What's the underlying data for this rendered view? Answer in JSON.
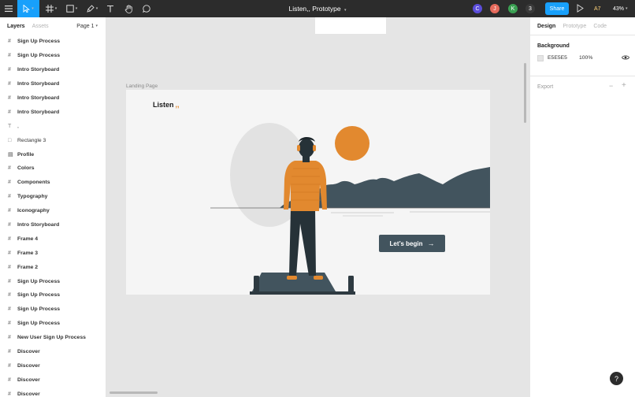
{
  "toolbar": {
    "doc_title": "Listen,, Prototype",
    "share_label": "Share",
    "a7_label": "A7",
    "zoom_label": "43%",
    "avatars": [
      {
        "letter": "C",
        "color": "#5b4ddb"
      },
      {
        "letter": "J",
        "color": "#e66a5c"
      },
      {
        "letter": "K",
        "color": "#3aa052"
      },
      {
        "letter": "3",
        "color": "#3a3a3a"
      }
    ],
    "active_tool_color": "#18a0fb"
  },
  "layers_panel": {
    "tabs": [
      "Layers",
      "Assets"
    ],
    "page_label": "Page 1",
    "items": [
      {
        "icon": "frame",
        "label": "Sign Up Process"
      },
      {
        "icon": "frame",
        "label": "Sign Up Process"
      },
      {
        "icon": "frame",
        "label": "Intro Storyboard"
      },
      {
        "icon": "frame",
        "label": "Intro Storyboard"
      },
      {
        "icon": "frame",
        "label": "Intro Storyboard"
      },
      {
        "icon": "frame",
        "label": "Intro Storyboard"
      },
      {
        "icon": "text",
        "label": ","
      },
      {
        "icon": "rect",
        "label": "Rectangle 3"
      },
      {
        "icon": "component",
        "label": "Profile"
      },
      {
        "icon": "frame",
        "label": "Colors"
      },
      {
        "icon": "frame",
        "label": "Components"
      },
      {
        "icon": "frame",
        "label": "Typography"
      },
      {
        "icon": "frame",
        "label": "Iconography"
      },
      {
        "icon": "frame",
        "label": "Intro Storyboard"
      },
      {
        "icon": "frame",
        "label": "Frame 4"
      },
      {
        "icon": "frame",
        "label": "Frame 3"
      },
      {
        "icon": "frame",
        "label": "Frame 2"
      },
      {
        "icon": "frame",
        "label": "Sign Up Process"
      },
      {
        "icon": "frame",
        "label": "Sign Up Process"
      },
      {
        "icon": "frame",
        "label": "Sign Up Process"
      },
      {
        "icon": "frame",
        "label": "Sign Up Process"
      },
      {
        "icon": "frame",
        "label": "New User Sign Up Process"
      },
      {
        "icon": "frame",
        "label": "Discover"
      },
      {
        "icon": "frame",
        "label": "Discover"
      },
      {
        "icon": "frame",
        "label": "Discover"
      },
      {
        "icon": "frame",
        "label": "Discover"
      }
    ]
  },
  "canvas": {
    "frame_label": "Landing Page",
    "logo_text": "Listen",
    "logo_dots": ",,",
    "cta_label": "Let’s begin",
    "cta_arrow": "→",
    "accent_orange": "#e2892f",
    "slate": "#42545e"
  },
  "design_panel": {
    "tabs": [
      "Design",
      "Prototype",
      "Code"
    ],
    "background_heading": "Background",
    "background_hex": "E5E5E5",
    "background_opacity": "100%",
    "export_label": "Export",
    "export_minus": "−",
    "export_plus": "+"
  },
  "help_label": "?"
}
